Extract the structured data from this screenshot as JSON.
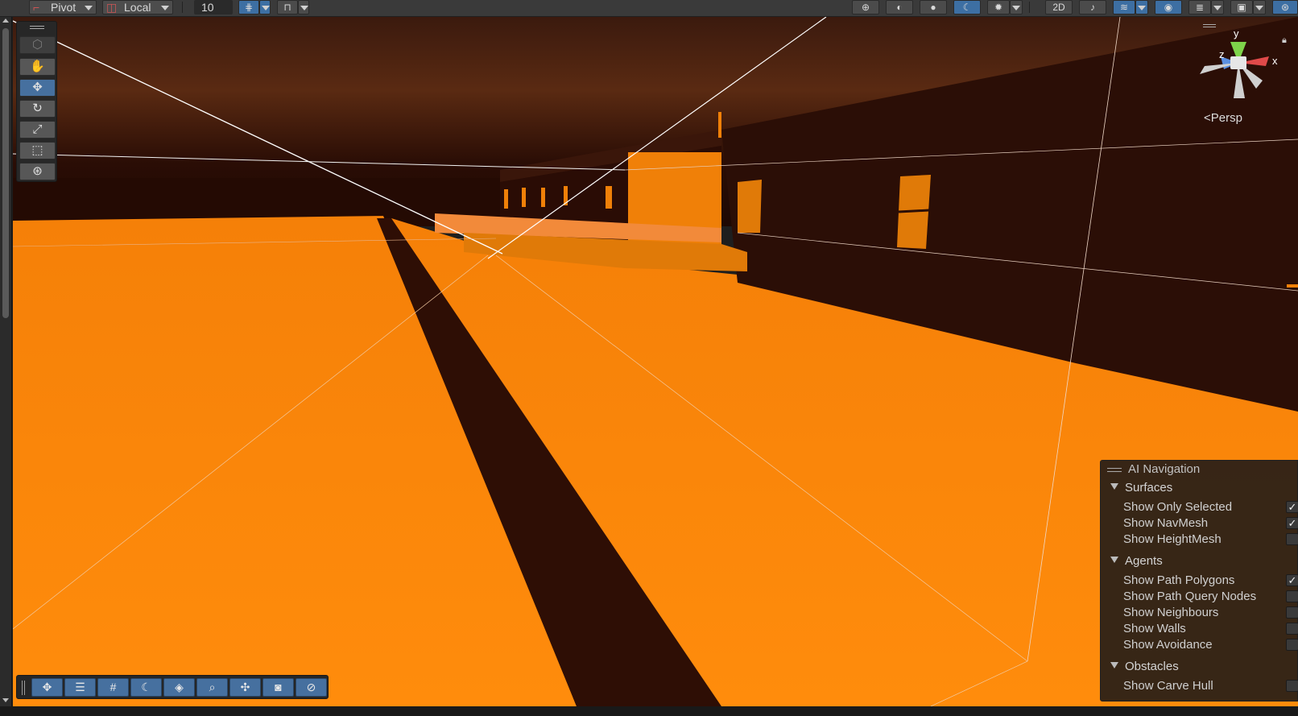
{
  "toolbar": {
    "pivot_label": "Pivot",
    "local_label": "Local",
    "grid_value": "10"
  },
  "scene_view": {
    "projection_label": "Persp",
    "gizmo_axes": {
      "x": "x",
      "y": "y",
      "z": "z"
    }
  },
  "ai_navigation": {
    "title": "AI Navigation",
    "sections": [
      {
        "label": "Surfaces",
        "items": [
          {
            "label": "Show Only Selected",
            "checked": true
          },
          {
            "label": "Show NavMesh",
            "checked": true
          },
          {
            "label": "Show HeightMesh",
            "checked": false
          }
        ]
      },
      {
        "label": "Agents",
        "items": [
          {
            "label": "Show Path Polygons",
            "checked": true
          },
          {
            "label": "Show Path Query Nodes",
            "checked": false
          },
          {
            "label": "Show Neighbours",
            "checked": false
          },
          {
            "label": "Show Walls",
            "checked": false
          },
          {
            "label": "Show Avoidance",
            "checked": false
          }
        ]
      },
      {
        "label": "Obstacles",
        "items": [
          {
            "label": "Show Carve Hull",
            "checked": false
          }
        ]
      }
    ]
  },
  "colors": {
    "ground": "#ff8a0a",
    "sky_dark": "#2a0d05",
    "wall_dark": "#2b0e06",
    "accent_blue": "#46709f"
  },
  "icons": {
    "tools": [
      "view-cube-icon",
      "hand-icon",
      "move-icon",
      "rotate-icon",
      "scale-icon",
      "rect-icon",
      "transform-icon"
    ],
    "overlays": [
      "move-overlay-icon",
      "sliders-icon",
      "grid-icon",
      "shading-icon",
      "layers-icon",
      "search-icon",
      "pivot-icon",
      "camera-icon",
      "compass-icon"
    ]
  }
}
